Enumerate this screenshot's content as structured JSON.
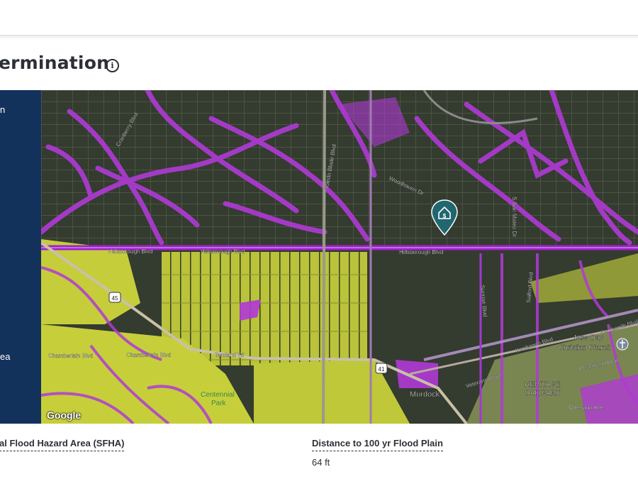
{
  "header": {
    "title": "ermination",
    "info_icon": "info-icon"
  },
  "left_panel": {
    "line_1": "n",
    "line_2": "ea"
  },
  "map": {
    "attribution": "Google",
    "property_marker_icon": "house-dollar-pin-icon",
    "flood_zone_color": "#b63ad8",
    "moderate_zone_color": "#d7e23a",
    "labels": {
      "hillsborough_1": "Hillsborough Blvd",
      "hillsborough_2": "Hillsborough Blvd",
      "hillsborough_3": "Hillsborough Blvd",
      "woodhaven": "Woodhaven Dr",
      "toledo_blade": "Toledo Blade Blvd",
      "tamiami": "Tamiami Trl",
      "chamberlain": "Chamberlain Blvd",
      "kenilworth": "Kenilworth Blvd",
      "murdock": "Murdock",
      "church_1": "New Day",
      "church_2": "Christian Church",
      "heritage_1": "HERITAGE",
      "heritage_2": "OAK PARK",
      "centennial_1": "Centennial",
      "centennial_2": "Park",
      "hwy_45": "45",
      "hwy_41": "41",
      "salford": "Salford Blvd",
      "peachland": "Peachland Blvd",
      "veterans": "Veterans Blvd",
      "sunrise": "Sunrise Blvd",
      "cranberry": "Cranberry Blvd",
      "san_mateo": "S San Mateo Dr",
      "quesada": "Quesada Ave"
    }
  },
  "footer": {
    "sfha_label": "al Flood Hazard Area (SFHA)",
    "distance_label": "Distance to 100 yr Flood Plain",
    "distance_value": "64 ft"
  }
}
